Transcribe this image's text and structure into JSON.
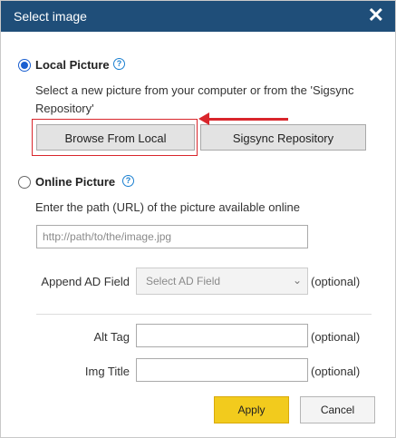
{
  "dialog": {
    "title": "Select image",
    "close_glyph": "✕",
    "accent_color": "#1f4e79"
  },
  "local": {
    "label": "Local Picture",
    "selected": true,
    "help_glyph": "?",
    "description": "Select a new picture from your computer or from the 'Sigsync Repository'",
    "browse_button": "Browse From Local",
    "repository_button": "Sigsync Repository"
  },
  "online": {
    "label": "Online Picture",
    "selected": false,
    "help_glyph": "?",
    "description": "Enter the path (URL) of the picture available online",
    "url_placeholder": "http://path/to/the/image.jpg"
  },
  "append": {
    "label": "Append AD Field",
    "select_value": "Select AD Field",
    "optional_text": "(optional)"
  },
  "alt_tag": {
    "label": "Alt Tag",
    "optional_text": "(optional)"
  },
  "img_title": {
    "label": "Img Title",
    "optional_text": "(optional)"
  },
  "footer": {
    "apply_label": "Apply",
    "cancel_label": "Cancel",
    "apply_color": "#f2cb1d"
  },
  "annotation": {
    "highlight_color": "#d9262c"
  }
}
